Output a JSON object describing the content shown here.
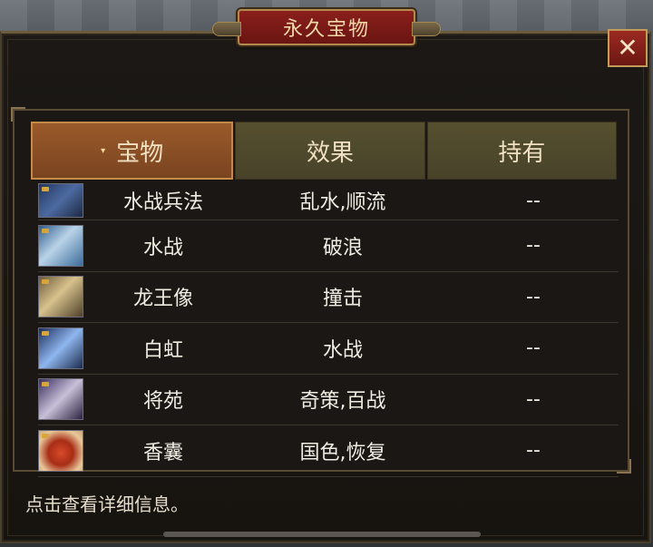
{
  "window": {
    "title": "永久宝物",
    "close_label": "✕"
  },
  "table": {
    "headers": {
      "treasure": "宝物",
      "effect": "效果",
      "owned": "持有"
    },
    "sort_indicator": "▾",
    "rows": [
      {
        "name": "水战兵法",
        "effect": "乱水,顺流",
        "owned": "--",
        "icon": "war-manual-icon"
      },
      {
        "name": "水战",
        "effect": "破浪",
        "owned": "--",
        "icon": "naval-battle-icon"
      },
      {
        "name": "龙王像",
        "effect": "撞击",
        "owned": "--",
        "icon": "dragon-king-statue-icon"
      },
      {
        "name": "白虹",
        "effect": "水战",
        "owned": "--",
        "icon": "white-rainbow-icon"
      },
      {
        "name": "将苑",
        "effect": "奇策,百战",
        "owned": "--",
        "icon": "general-book-icon"
      },
      {
        "name": "香囊",
        "effect": "国色,恢复",
        "owned": "--",
        "icon": "sachet-icon"
      }
    ]
  },
  "footer": {
    "hint": "点击查看详细信息。"
  },
  "colors": {
    "title_plate": "#8a1f1c",
    "active_header": "#9a5a2a",
    "inactive_header": "#56502f",
    "text": "#f1ece2",
    "gold_border": "#c29b5a"
  }
}
